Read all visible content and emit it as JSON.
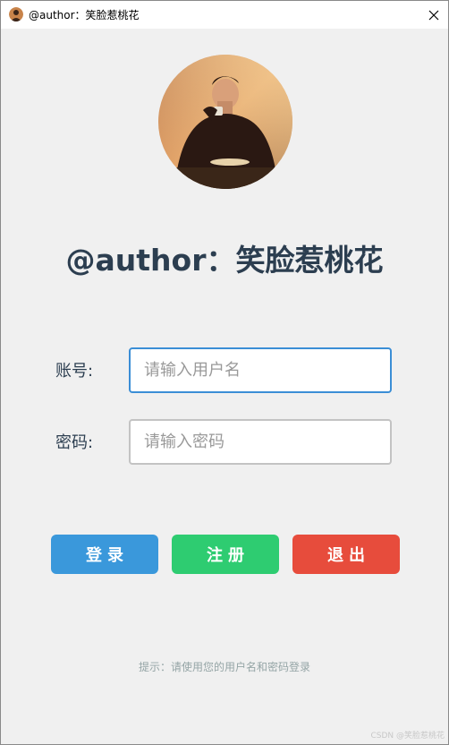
{
  "window": {
    "title": "@author：笑脸惹桃花"
  },
  "login": {
    "heading": "@author：笑脸惹桃花",
    "username_label": "账号:",
    "username_placeholder": "请输入用户名",
    "username_value": "",
    "password_label": "密码:",
    "password_placeholder": "请输入密码",
    "password_value": "",
    "login_button": "登录",
    "register_button": "注册",
    "exit_button": "退出",
    "hint": "提示：请使用您的用户名和密码登录"
  },
  "watermark": "CSDN @笑脸惹桃花",
  "colors": {
    "login": "#3a98db",
    "register": "#2ecc71",
    "exit": "#e74c3c",
    "heading": "#2c3e50"
  },
  "icons": {
    "close": "close-icon",
    "avatar": "avatar-photo"
  }
}
